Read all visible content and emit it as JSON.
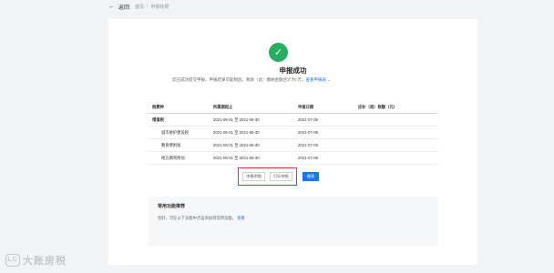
{
  "nav": {
    "back_arrow": "←",
    "back_label": "返回",
    "breadcrumb": [
      "首页",
      "申报结果"
    ]
  },
  "result": {
    "icon": "check-circle-icon",
    "title": "申报成功",
    "desc_prefix": "您已成功提交申报，申报结果可能稍后。税款（含）缴纳金额合计为",
    "desc_amount": "0",
    "desc_unit": "元",
    "desc_middle": "，",
    "desc_link": "查看申报表 ⌄"
  },
  "table": {
    "headers": [
      "税费种",
      "所属期起止",
      "申报日期",
      "应补（退）税额（元）"
    ],
    "rows": [
      {
        "name": "增值税",
        "period": "2021-06-01 至 2021-06-30",
        "date": "2021-07-05",
        "amount": "",
        "sub": false
      },
      {
        "name": "城市维护建设税",
        "period": "2021-06-01 至 2021-06-30",
        "date": "2021-07-05",
        "amount": "",
        "sub": true
      },
      {
        "name": "教育费附加",
        "period": "2021-06-01 至 2021-06-30",
        "date": "2021-07-05",
        "amount": "",
        "sub": true
      },
      {
        "name": "地方教育附加",
        "period": "2021-06-01 至 2021-06-30",
        "date": "2021-07-05",
        "amount": "",
        "sub": true
      }
    ]
  },
  "actions": {
    "btn1": "申报明细",
    "btn2": "打印申报",
    "btn3": "缴款"
  },
  "favorites": {
    "title": "常用功能推荐",
    "desc": "您好，可在以下功能中点击添加到常用功能。",
    "link": "查看"
  },
  "watermark": {
    "logo": "LC",
    "text": "大账房税"
  },
  "colors": {
    "success": "#27ae60",
    "primary": "#1677ff",
    "highlight": "#d9363e"
  }
}
